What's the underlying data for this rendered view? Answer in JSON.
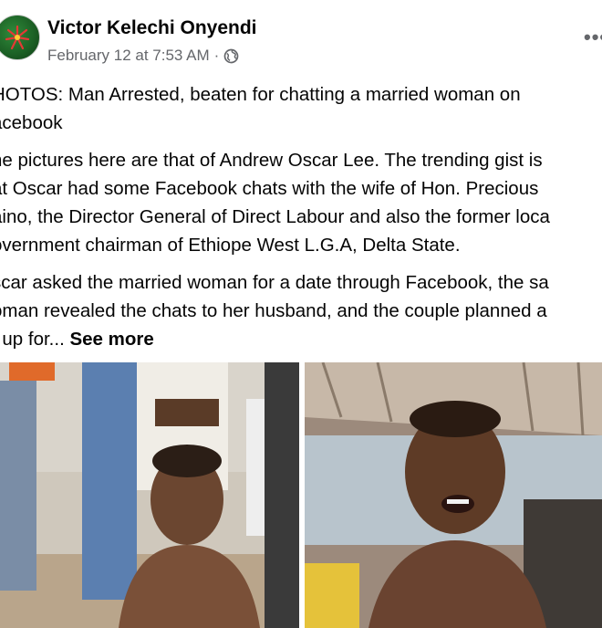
{
  "post": {
    "author": "Victor Kelechi Onyendi",
    "timestamp": "February 12 at 7:53 AM",
    "separator": "·",
    "privacy_icon": "globe-icon",
    "more_icon": "more-options-icon",
    "more_glyph": "•••",
    "text_lines": [
      [
        "HOTOS: Man Arrested, beaten for chatting a married woman on",
        "acebook"
      ],
      [
        "he pictures here are that of Andrew Oscar Lee. The trending gist is",
        "at Oscar had some Facebook chats with the wife of Hon. Precious",
        "aino, the Director General of Direct Labour and also the former loca",
        "overnment chairman of Ethiope West L.G.A, Delta State."
      ],
      [
        "scar asked the married woman for a date through Facebook, the sa",
        "oman revealed the chats to her husband, and the couple planned a"
      ]
    ],
    "last_line": "t up for...",
    "see_more": "See more"
  },
  "photos": [
    {
      "subject": "shirtless man seated outdoors surrounded by people"
    },
    {
      "subject": "shirtless man speaking close-up under a roof"
    }
  ],
  "colors": {
    "text": "#050505",
    "secondary": "#65676b",
    "background": "#ffffff"
  }
}
